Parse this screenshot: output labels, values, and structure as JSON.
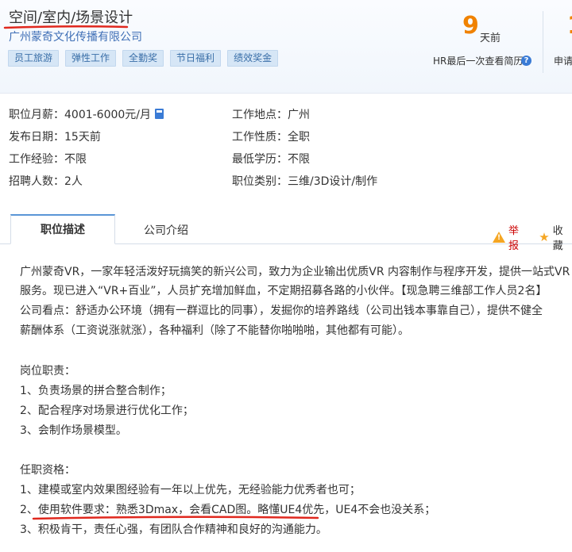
{
  "header": {
    "job_title": "空间/室内/场景设计",
    "company": "广州蒙奇文化传播有限公司",
    "tags": [
      "员工旅游",
      "弹性工作",
      "全勤奖",
      "节日福利",
      "绩效奖金"
    ],
    "days_num": "9",
    "days_unit": "天前",
    "hr_note": "HR最后一次查看简历",
    "help_icon": "?",
    "apply_label": "申请"
  },
  "info": {
    "salary_label": "职位月薪：",
    "salary_value": "4001-6000元/月",
    "location_label": "工作地点：",
    "location_value": "广州",
    "date_label": "发布日期：",
    "date_value": "15天前",
    "nature_label": "工作性质：",
    "nature_value": "全职",
    "exp_label": "工作经验：",
    "exp_value": "不限",
    "edu_label": "最低学历：",
    "edu_value": "不限",
    "count_label": "招聘人数：",
    "count_value": "2人",
    "category_label": "职位类别：",
    "category_value": "三维/3D设计/制作"
  },
  "tabs": {
    "active": "职位描述",
    "other": "公司介绍",
    "report": "举报",
    "favorite": "收藏"
  },
  "description": {
    "intro": [
      "广州蒙奇VR，一家年轻活泼好玩搞笑的新兴公司，致力为企业输出优质VR 内容制作与程序开发，提供一站式VR",
      "服务。现已进入“VR+百业”，人员扩充增加鲜血，不定期招募各路的小伙伴。【现急聘三维部工作人员2名】",
      "公司看点：舒适办公环境（拥有一群逗比的同事），发掘你的培养路线（公司出钱本事靠自己），提供不健全",
      "薪酬体系（工资说涨就涨），各种福利（除了不能替你啪啪啪，其他都有可能）。"
    ],
    "duties_title": "岗位职责：",
    "duties": [
      "1、负责场景的拼合整合制作；",
      "2、配合程序对场景进行优化工作；",
      "3、会制作场景模型。"
    ],
    "req_title": "任职资格：",
    "reqs": [
      "1、建模或室内效果图经验有一年以上优先，无经验能力优秀者也可；",
      "2、使用软件要求：熟悉3Dmax，会看CAD图。略懂UE4优先，UE4不会也没关系；",
      "3、积极肯干，责任心强，有团队合作精神和良好的沟通能力。"
    ]
  }
}
